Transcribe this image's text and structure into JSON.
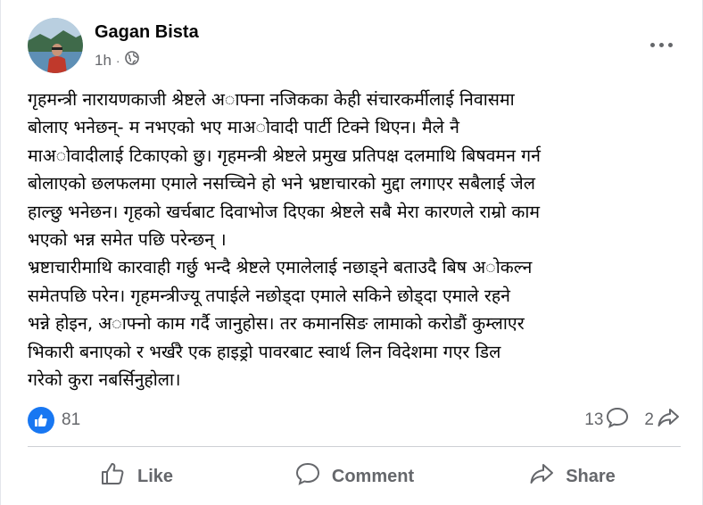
{
  "post": {
    "author": "Gagan Bista",
    "time": "1h",
    "privacy_icon": "globe-icon",
    "text_lines": [
      "गृहमन्त्री नारायणकाजी श्रेष्टले अाफ्ना नजिकका केही संचारकर्मीलाई निवासमा",
      "बोलाए भनेछन्- म नभएको भए माअाेवादी पार्टी टिक्ने थिएन। मैले नै",
      "माअाेवादीलाई टिकाएको छु। गृहमन्त्री श्रेष्टले प्रमुख प्रतिपक्ष दलमाथि बिषवमन गर्न",
      "बोलाएको छलफलमा एमाले नसच्चिने हो भने भ्रष्टाचारको मुद्दा लगाएर सबैलाई जेल",
      "हाल्छु भनेछन। गृहको खर्चबाट दिवाभोज दिएका श्रेष्टले सबै मेरा कारणले राम्रो काम",
      "भएको भन्न समेत पछि परेन्छन् ।",
      "भ्रष्टाचारीमाथि कारवाही गर्छु भन्दै श्रेष्टले एमालेलाई नछाड्ने बताउदै बिष अाेकल्न",
      "समेतपछि परेन। गृहमन्त्रीज्यू तपाईले नछोड्दा एमाले सकिने छोड्दा एमाले रहने",
      "भन्ने होइन, अाफ्नो काम गर्दै जानुहोस। तर कमानसिङ लामाको करोडौं कुम्लाएर",
      "भिकारी बनाएको र भर्खरै एक हाइड्रो पावरबाट स्वार्थ लिन विदेशमा गएर डिल",
      "गरेको कुरा नबर्सिनुहोला।"
    ]
  },
  "reactions": {
    "like_count": "81",
    "comment_count": "13",
    "share_count": "2"
  },
  "actions": {
    "like_label": "Like",
    "comment_label": "Comment",
    "share_label": "Share"
  },
  "colors": {
    "brand_blue": "#1877f2",
    "secondary_text": "#65676b",
    "divider": "#ced0d4"
  }
}
